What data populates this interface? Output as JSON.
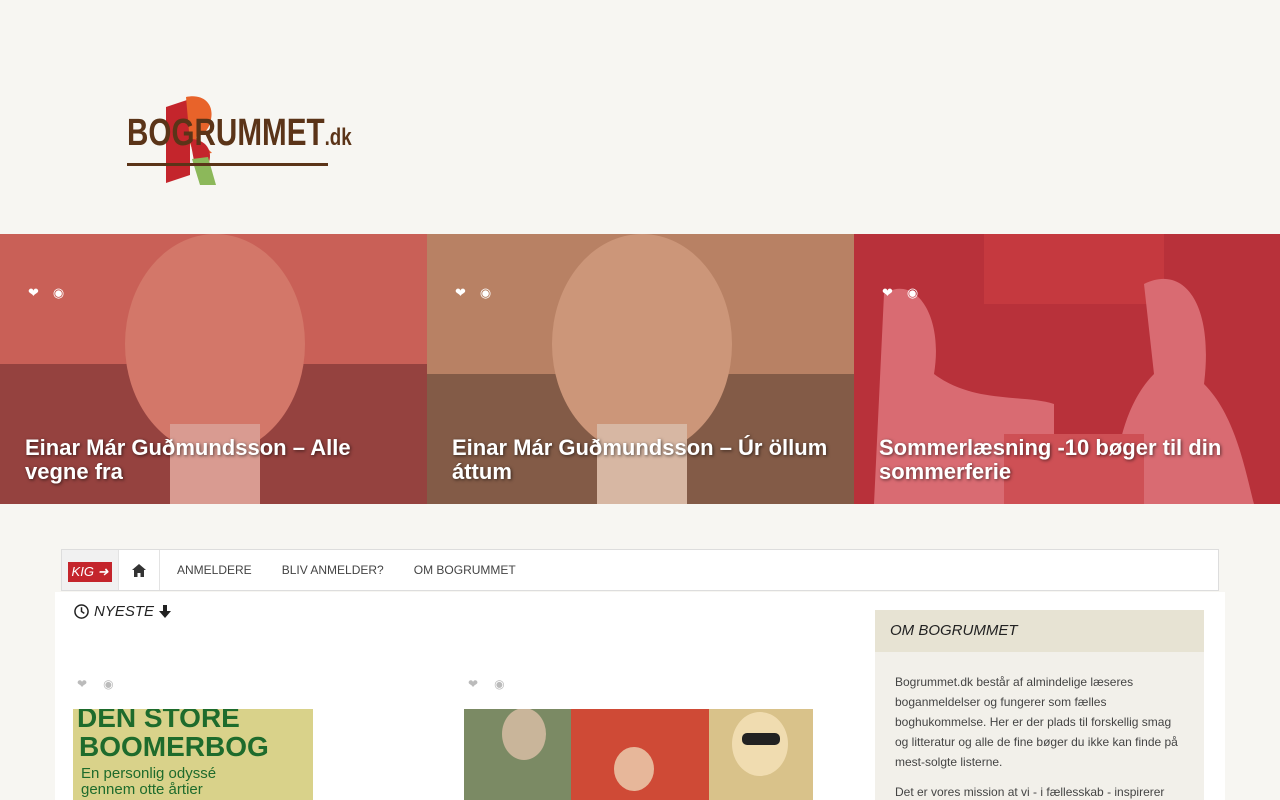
{
  "site": {
    "logo_text": "BOGRUMMET",
    "logo_suffix": ".dk",
    "brand_colors": {
      "red": "#c4252c",
      "orange": "#e8632a",
      "green": "#8cb85a",
      "brown": "#5b3418"
    }
  },
  "slider": {
    "slides": [
      {
        "title": "Einar Már Guðmundsson – Alle vegne fra",
        "tint": "#c9544c"
      },
      {
        "title": "Einar Már Guðmundsson – Úr öllum áttum",
        "tint": "#b77a5e"
      },
      {
        "title": "Sommerlæsning -10 bøger til din sommerferie",
        "tint": "#b8313a"
      }
    ]
  },
  "nav": {
    "kig_label": "KIG",
    "items": [
      {
        "label": "ANMELDERE"
      },
      {
        "label": "BLIV ANMELDER?"
      },
      {
        "label": "OM BOGRUMMET"
      }
    ]
  },
  "main": {
    "section_label": "NYESTE",
    "posts": [
      {
        "cover_lines": [
          "DEN STORE",
          "BOOMERBOG",
          "En personlig odyssé",
          "gennem otte årtier"
        ]
      },
      {
        "cover_lines": []
      }
    ]
  },
  "sidebar": {
    "widget_title": "OM BOGRUMMET",
    "paragraphs": [
      "Bogrummet.dk består af almindelige læseres boganmeldelser og fungerer som fælles boghukommelse. Her er der plads til forskellig smag og litteratur og alle de fine bøger du ikke kan finde på mest-solgte listerne.",
      "Det er vores mission at vi - i fællesskab - inspirerer"
    ]
  }
}
